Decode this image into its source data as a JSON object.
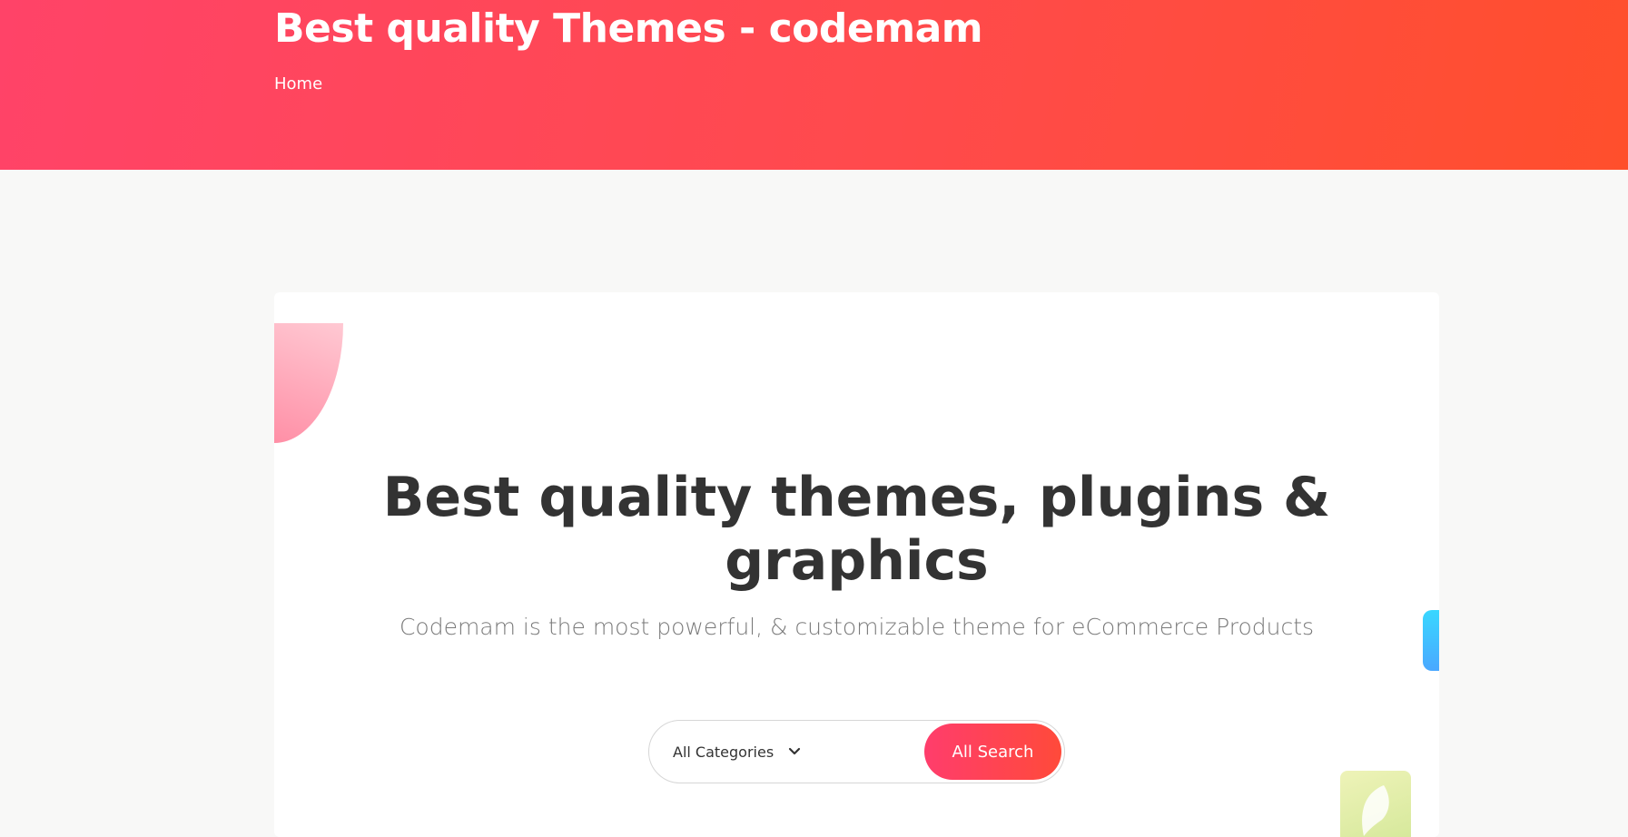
{
  "hero": {
    "title": "Best quality Themes - codemam",
    "breadcrumb": "Home",
    "gradient_start": "#ff4368",
    "gradient_end": "#ff4f2c"
  },
  "main": {
    "headline": "Best quality themes, plugins & graphics",
    "subtitle": "Codemam is the most powerful, & customizable theme for eCommerce Products",
    "search": {
      "category_selected": "All Categories",
      "category_icon": "chevron-down-icon",
      "button_label": "All Search",
      "button_color": "#ff4a3a"
    },
    "decorations": {
      "petal_color": "#ff8fa6",
      "blue_tab_color": "#39d7ff",
      "green_tile_color": "#d5e89a",
      "green_tile_icon": "leaf-icon"
    }
  }
}
